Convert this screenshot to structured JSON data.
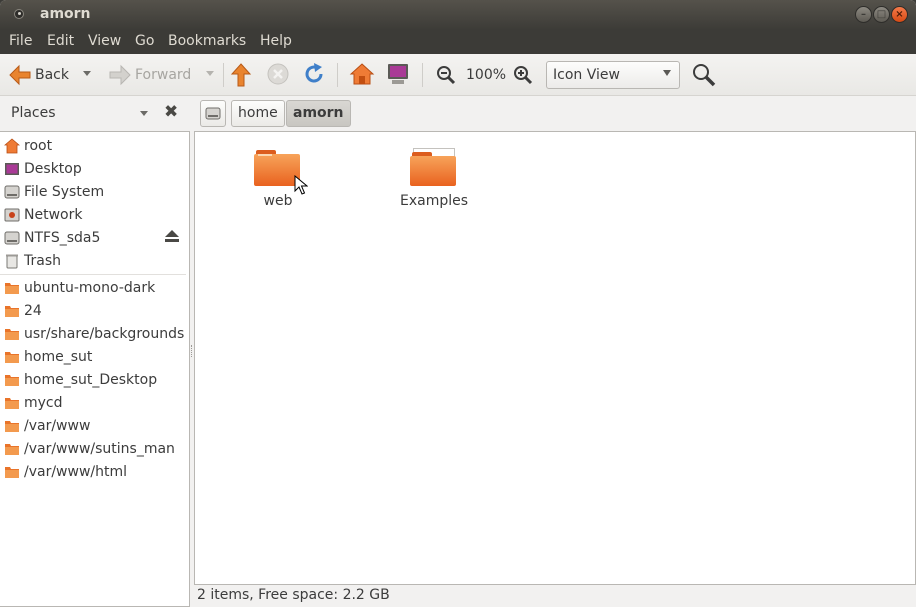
{
  "window": {
    "title": "amorn"
  },
  "menu": [
    "File",
    "Edit",
    "View",
    "Go",
    "Bookmarks",
    "Help"
  ],
  "toolbar": {
    "back": "Back",
    "forward": "Forward",
    "zoom": "100%",
    "view_mode": "Icon View"
  },
  "places": {
    "label": "Places",
    "devices": [
      {
        "label": "root",
        "icon": "home-folder-icon"
      },
      {
        "label": "Desktop",
        "icon": "desktop-icon"
      },
      {
        "label": "File System",
        "icon": "harddisk-icon"
      },
      {
        "label": "Network",
        "icon": "network-icon"
      },
      {
        "label": "NTFS_sda5",
        "icon": "harddisk-icon"
      },
      {
        "label": "Trash",
        "icon": "trash-icon"
      }
    ],
    "bookmarks": [
      "ubuntu-mono-dark",
      "24",
      "usr/share/backgrounds",
      "home_sut",
      "home_sut_Desktop",
      "mycd",
      "/var/www",
      "/var/www/sutins_man",
      "/var/www/html"
    ]
  },
  "path": {
    "segments": [
      "home",
      "amorn"
    ],
    "active": "amorn"
  },
  "files": [
    {
      "name": "web",
      "icon": "folder-icon"
    },
    {
      "name": "Examples",
      "icon": "folder-icon"
    }
  ],
  "status": "2 items, Free space: 2.2 GB",
  "colors": {
    "accent": "#e9621f",
    "titlebar": "#3c3b37",
    "close": "#e35720"
  }
}
